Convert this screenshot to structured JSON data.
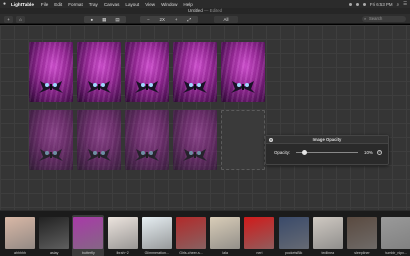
{
  "menubar": {
    "apple": "",
    "items": [
      "LightTable",
      "File",
      "Edit",
      "Format",
      "Tray",
      "Canvas",
      "Layout",
      "View",
      "Window",
      "Help"
    ],
    "clock": "Fri 6:53 PM"
  },
  "window": {
    "title": "Untitled",
    "edited": "— Edited"
  },
  "toolbar": {
    "zoom_label": "2X",
    "all_label": "All",
    "search_placeholder": "Search",
    "icons": [
      "plus-icon",
      "share-icon",
      "arrange-icons",
      "zoom-controls"
    ]
  },
  "canvas": {
    "row1_count": 5,
    "row2_count": 5
  },
  "inspector": {
    "title": "Image Opacity",
    "label": "Opacity:",
    "value": "10%",
    "opacity_fraction": 0.1
  },
  "filmstrip": {
    "items": [
      {
        "label": "ahhhhh",
        "color": "#d9b8a6"
      },
      {
        "label": "asiay",
        "color": "#222"
      },
      {
        "label": "butterfly",
        "color": "#a83aa8"
      },
      {
        "label": "Ibrah~2",
        "color": "#ece4de"
      },
      {
        "label": "Glimmeration...",
        "color": "#e6eef2"
      },
      {
        "label": "Girls-cheer-s...",
        "color": "#b22a2a"
      },
      {
        "label": "lala",
        "color": "#d9cdb8"
      },
      {
        "label": "neri",
        "color": "#d11a1a"
      },
      {
        "label": "pocketsBlk",
        "color": "#3a4a6a"
      },
      {
        "label": "tedlinea",
        "color": "#cfc9c2"
      },
      {
        "label": "sleepliner",
        "color": "#5a4a40"
      },
      {
        "label": "tumblr_nlpx...",
        "color": "#9a9a9a"
      }
    ],
    "selected_index": 2
  },
  "colors": {
    "accent_photo": "#a83aa8",
    "background": "#353535"
  }
}
